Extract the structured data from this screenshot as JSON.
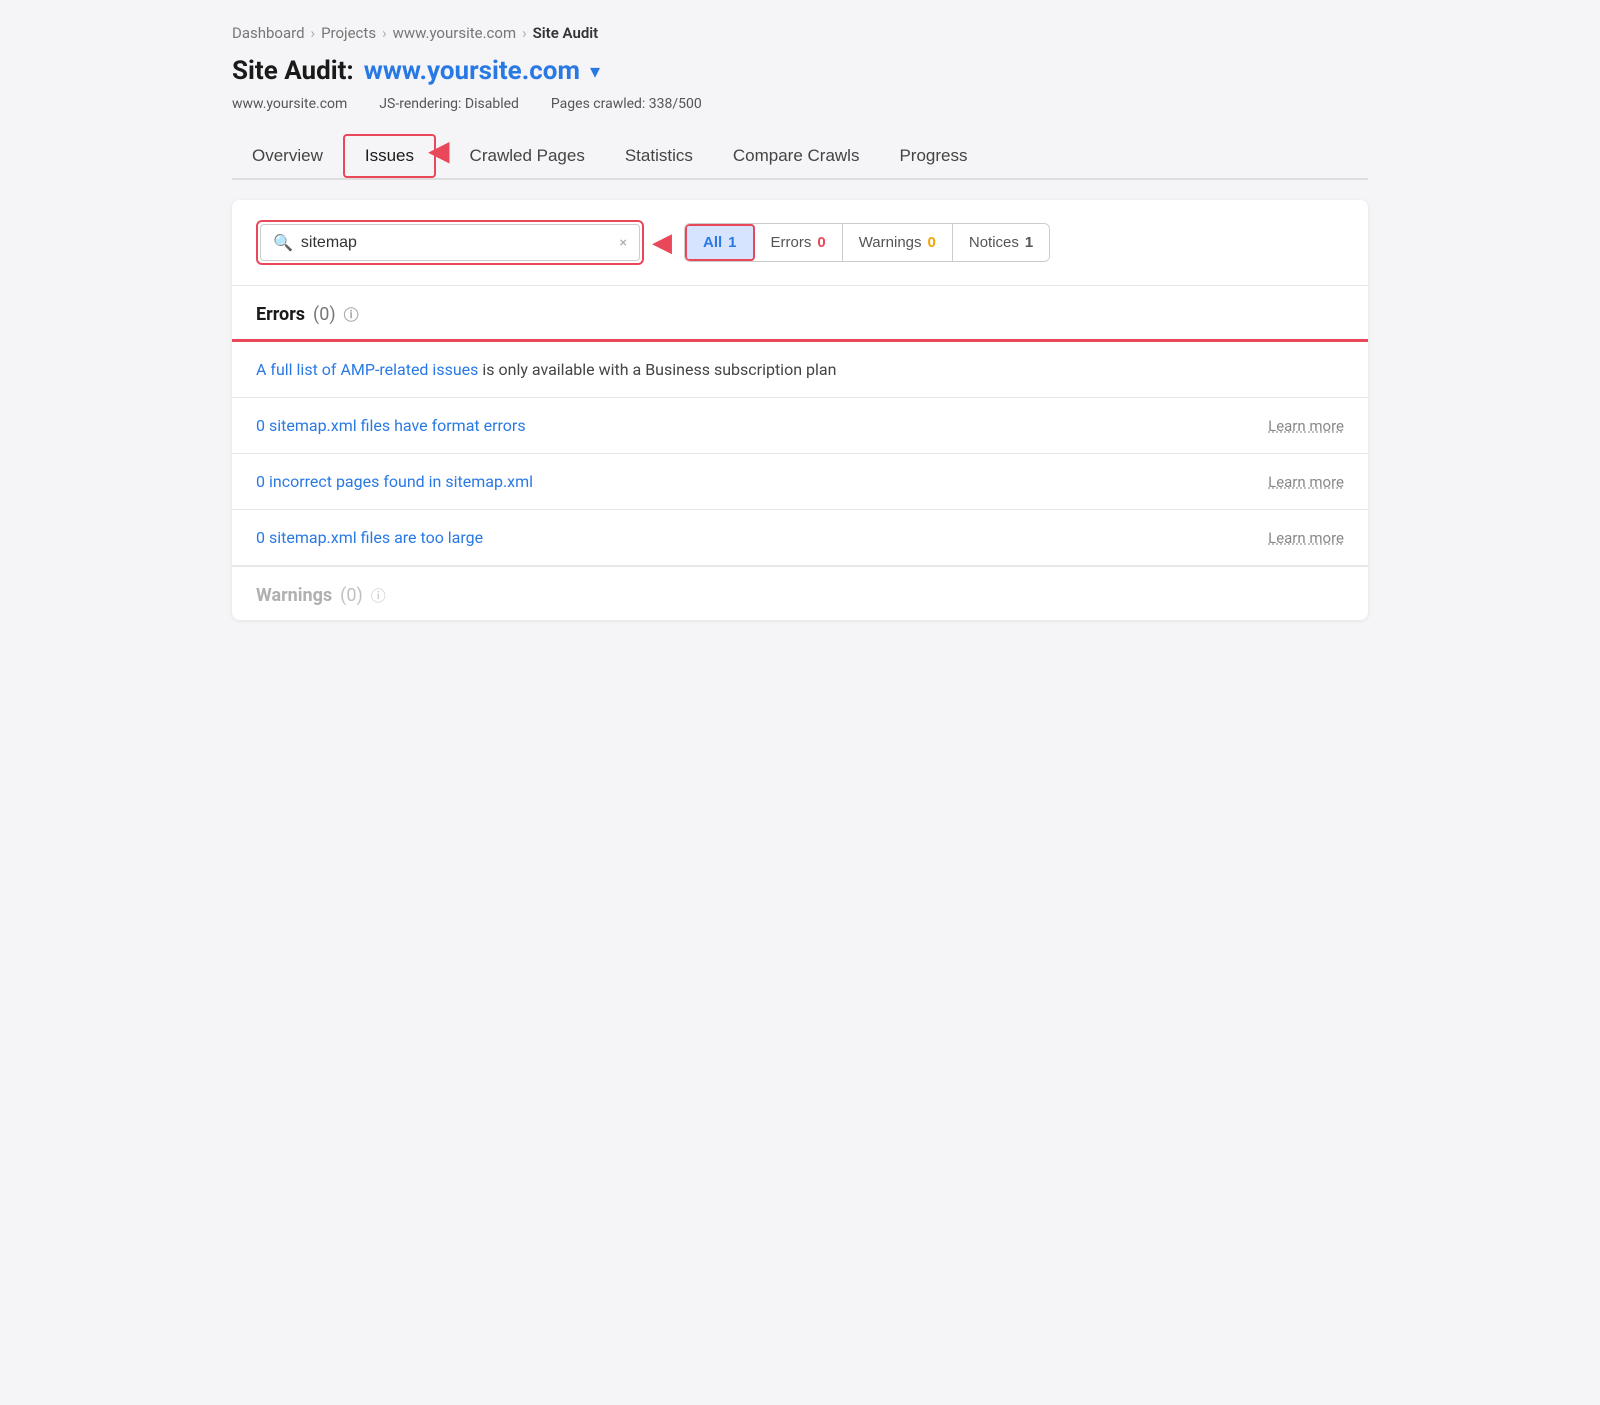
{
  "breadcrumb": {
    "items": [
      "Dashboard",
      "Projects",
      "www.yoursite.com",
      "Site Audit"
    ]
  },
  "header": {
    "title_label": "Site Audit:",
    "site_name": "www.yoursite.com",
    "meta": {
      "domain": "www.yoursite.com",
      "js_rendering": "JS-rendering: Disabled",
      "pages_crawled": "Pages crawled: 338/500"
    }
  },
  "tabs": [
    {
      "id": "overview",
      "label": "Overview"
    },
    {
      "id": "issues",
      "label": "Issues",
      "active": true,
      "highlighted": true
    },
    {
      "id": "crawled-pages",
      "label": "Crawled Pages"
    },
    {
      "id": "statistics",
      "label": "Statistics"
    },
    {
      "id": "compare-crawls",
      "label": "Compare Crawls"
    },
    {
      "id": "progress",
      "label": "Progress"
    }
  ],
  "filter": {
    "search_value": "sitemap",
    "search_placeholder": "sitemap",
    "clear_icon": "×",
    "buttons": [
      {
        "id": "all",
        "label": "All",
        "count": "1",
        "selected": true
      },
      {
        "id": "errors",
        "label": "Errors",
        "count": "0"
      },
      {
        "id": "warnings",
        "label": "Warnings",
        "count": "0"
      },
      {
        "id": "notices",
        "label": "Notices",
        "count": "1"
      }
    ]
  },
  "errors_section": {
    "title": "Errors",
    "count": "(0)",
    "info_icon": "i"
  },
  "amp_notice": {
    "link_text": "A full list of AMP-related issues",
    "rest_text": " is only available with a Business subscription plan"
  },
  "issue_rows": [
    {
      "id": "sitemap-format",
      "text": "0 sitemap.xml files have format errors",
      "learn_more": "Learn more"
    },
    {
      "id": "sitemap-incorrect",
      "text": "0 incorrect pages found in sitemap.xml",
      "learn_more": "Learn more"
    },
    {
      "id": "sitemap-large",
      "text": "0 sitemap.xml files are too large",
      "learn_more": "Learn more"
    }
  ],
  "warnings_section": {
    "title": "Warnings",
    "count": "(0)",
    "info_icon": "i"
  },
  "icons": {
    "search": "🔍",
    "chevron_down": "▾",
    "arrow_left": "◀"
  }
}
